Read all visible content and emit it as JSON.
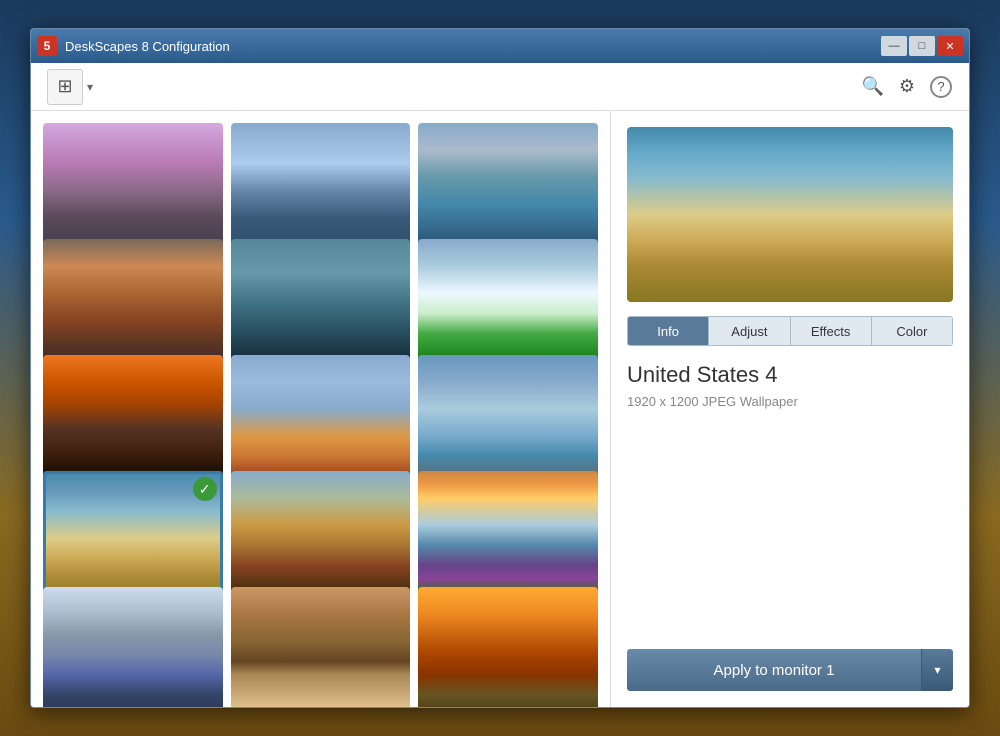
{
  "window": {
    "title": "DeskScapes 8 Configuration",
    "icon_label": "5",
    "controls": {
      "minimize": "—",
      "maximize": "□",
      "close": "✕"
    }
  },
  "toolbar": {
    "library_icon": "⊞",
    "search_icon": "🔍",
    "settings_icon": "⚙",
    "help_icon": "?"
  },
  "gallery": {
    "thumbnails": [
      {
        "id": "thumb-1",
        "class": "img-stonehenge",
        "selected": false
      },
      {
        "id": "thumb-2",
        "class": "img-london",
        "selected": false
      },
      {
        "id": "thumb-3",
        "class": "img-boats",
        "selected": false
      },
      {
        "id": "thumb-4",
        "class": "img-rocks",
        "selected": false
      },
      {
        "id": "thumb-5",
        "class": "img-castle-sea",
        "selected": false
      },
      {
        "id": "thumb-6",
        "class": "img-cliffs",
        "selected": false
      },
      {
        "id": "thumb-7",
        "class": "img-mountains-sunset",
        "selected": false
      },
      {
        "id": "thumb-8",
        "class": "img-lighthouse",
        "selected": false
      },
      {
        "id": "thumb-9",
        "class": "img-haystack-rock",
        "selected": false
      },
      {
        "id": "thumb-10",
        "class": "img-hay-bale",
        "selected": true,
        "checked": true
      },
      {
        "id": "thumb-11",
        "class": "img-arch",
        "selected": false
      },
      {
        "id": "thumb-12",
        "class": "img-purple-flowers",
        "selected": false
      },
      {
        "id": "thumb-13",
        "class": "img-mountain2",
        "selected": false
      },
      {
        "id": "thumb-14",
        "class": "img-valley",
        "selected": false
      },
      {
        "id": "thumb-15",
        "class": "img-sunset2",
        "selected": false
      }
    ]
  },
  "detail": {
    "tabs": [
      {
        "id": "tab-info",
        "label": "Info",
        "active": true
      },
      {
        "id": "tab-adjust",
        "label": "Adjust",
        "active": false
      },
      {
        "id": "tab-effects",
        "label": "Effects",
        "active": false
      },
      {
        "id": "tab-color",
        "label": "Color",
        "active": false
      }
    ],
    "wallpaper_title": "United States 4",
    "wallpaper_meta": "1920 x 1200 JPEG Wallpaper",
    "apply_button_label": "Apply to monitor 1",
    "dropdown_arrow": "▾"
  }
}
